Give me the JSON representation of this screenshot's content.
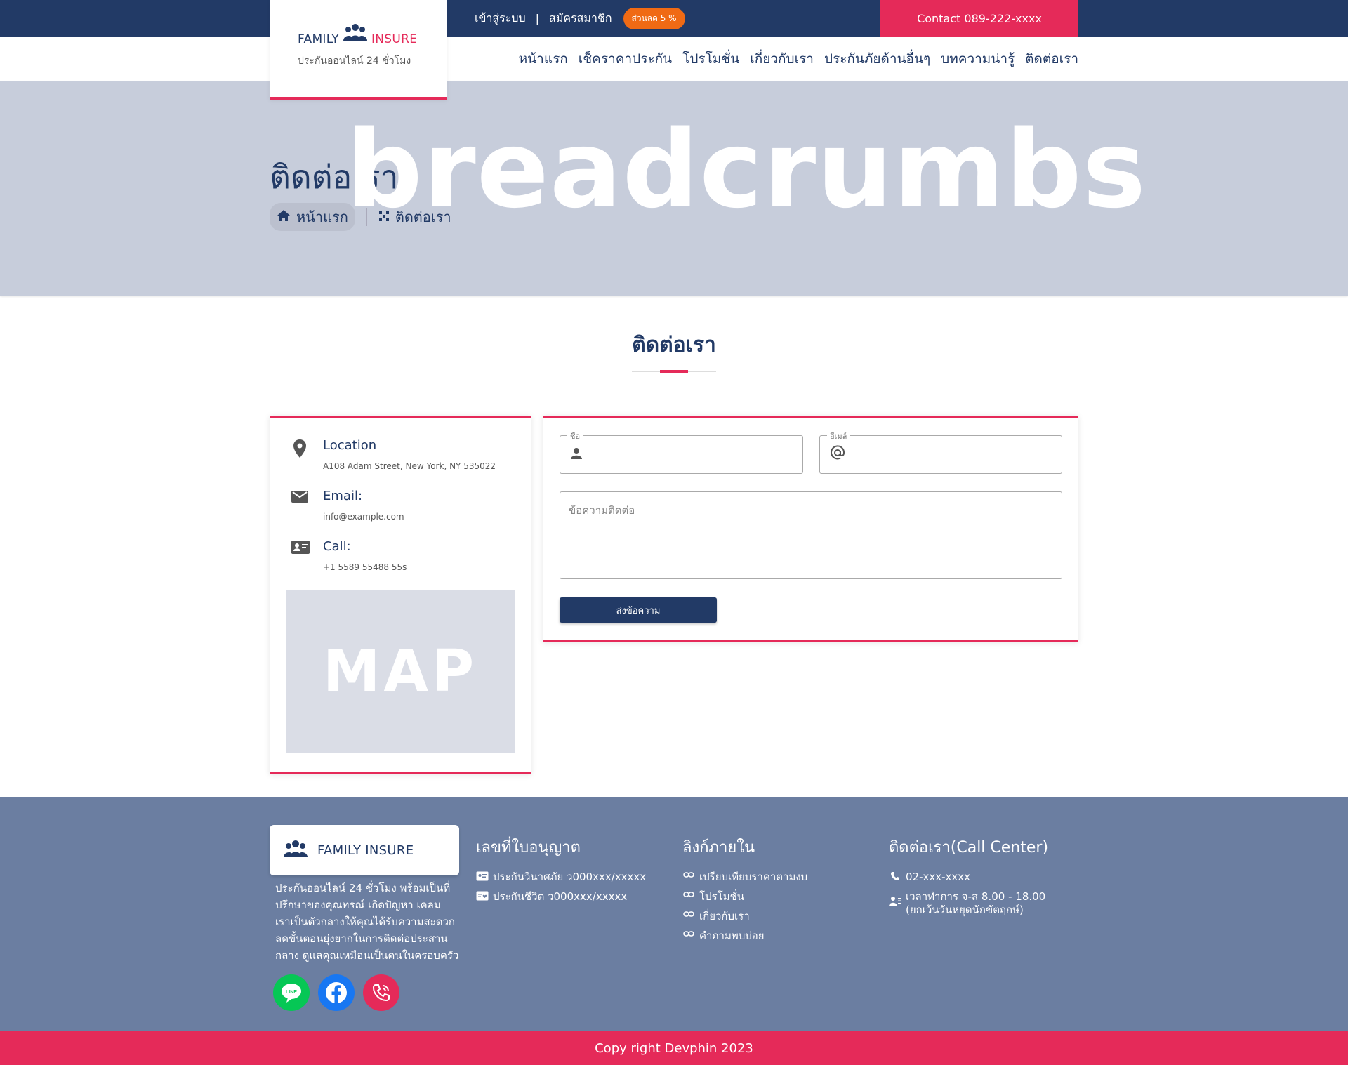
{
  "topbar": {
    "login": "เข้าสู่ระบบ",
    "separator": "|",
    "register": "สมัครสมาชิก",
    "discount_badge": "ส่วนลด 5 %",
    "contact": "Contact 089-222-xxxx"
  },
  "logo": {
    "family": "FAMILY",
    "insure": "INSURE",
    "tagline": "ประกันออนไลน์ 24 ชั่วโมง"
  },
  "nav": {
    "items": [
      {
        "label": "หน้าแรก"
      },
      {
        "label": "เช็คราคาประกัน"
      },
      {
        "label": "โปรโมชั่น"
      },
      {
        "label": "เกี่ยวกับเรา"
      },
      {
        "label": "ประกันภัยด้านอื่นๆ"
      },
      {
        "label": "บทความน่ารู้"
      },
      {
        "label": "ติดต่อเรา"
      }
    ]
  },
  "hero": {
    "watermark": "breadcrumbs",
    "title": "ติดต่อเรา",
    "breadcrumb_home": "หน้าแรก",
    "breadcrumb_current": "ติดต่อเรา"
  },
  "section": {
    "title": "ติดต่อเรา"
  },
  "info": {
    "location_label": "Location",
    "location_value": "A108 Adam Street, New York, NY 535022",
    "email_label": "Email:",
    "email_value": "info@example.com",
    "call_label": "Call:",
    "call_value": "+1 5589 55488 55s",
    "map_text": "MAP"
  },
  "form": {
    "name_label": "ชื่อ",
    "email_label": "อีเมล์",
    "message_placeholder": "ข้อความติดต่อ",
    "submit": "ส่งข้อความ"
  },
  "footer": {
    "logo_text": "FAMILY INSURE",
    "description": "ประกันออนไลน์ 24 ชั่วโมง พร้อมเป็นที่ปรึกษาของคุณทรณ์ เกิดปัญหา เคลม เราเป็นตัวกลางให้คุณได้รับความสะดวก ลดขั้นตอนยุ่งยากในการติดต่อประสาน กลาง ดูแลคุณเหมือนเป็นคนในครอบครัว",
    "license": {
      "title": "เลขที่ใบอนุญาต",
      "items": [
        "ประกันวินาศภัย ว000xxx/xxxxx",
        "ประกันชีวิต ว000xxx/xxxxx"
      ]
    },
    "links": {
      "title": "ลิงก์ภายใน",
      "items": [
        "เปรียบเทียบราคาตามงบ",
        "โปรโมชั่น",
        "เกี่ยวกับเรา",
        "คำถามพบบ่อย"
      ]
    },
    "contact": {
      "title": "ติดต่อเรา(Call Center)",
      "phone": "02-xxx-xxxx",
      "hours": "เวลาทำการ จ-ส 8.00 - 18.00",
      "hours_note": "(ยกเว้นวันหยุดนักขัตฤกษ์)"
    },
    "copyright": "Copy right Devphin 2023"
  },
  "colors": {
    "navy": "#223a66",
    "accent": "#e52a59",
    "badge": "#f06a14",
    "footer": "#6b7ea1",
    "hero": "#c7cddb"
  },
  "icons": {
    "social": [
      "line-icon",
      "facebook-icon",
      "phone-icon"
    ]
  }
}
